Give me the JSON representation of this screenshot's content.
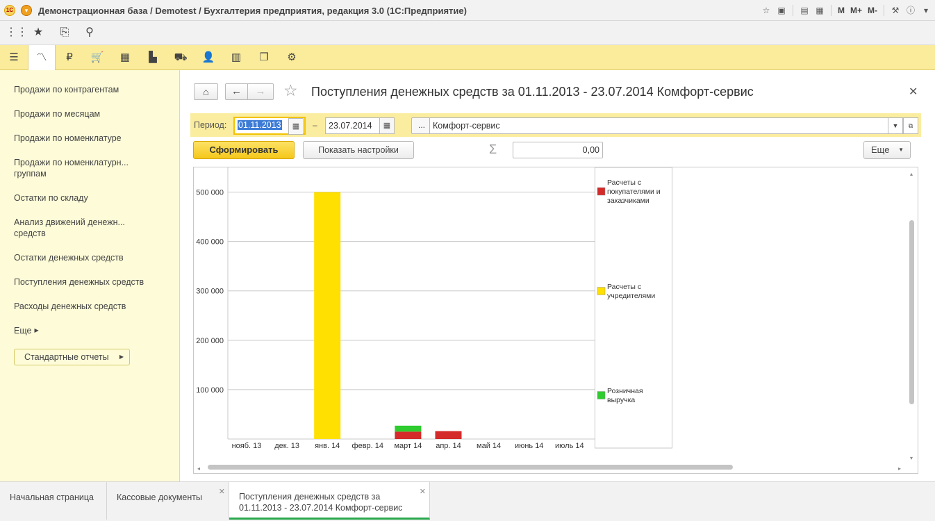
{
  "window": {
    "title": "Демонстрационная база / Demotest / Бухгалтерия предприятия, редакция 3.0 (1С:Предприятие)",
    "logo_text": "1С",
    "m_labels": [
      "M",
      "M+",
      "M-"
    ]
  },
  "sidebar": {
    "items": [
      "Продажи по контрагентам",
      "Продажи по месяцам",
      "Продажи по номенклатуре",
      "Продажи по номенклатурн... группам",
      "Остатки по складу",
      "Анализ движений денежн... средств",
      "Остатки денежных средств",
      "Поступления денежных средств",
      "Расходы денежных средств",
      "Еще"
    ],
    "std_button": "Стандартные отчеты"
  },
  "report": {
    "title": "Поступления денежных средств за 01.11.2013 - 23.07.2014 Комфорт-сервис",
    "period_label": "Период:",
    "date_from": "01.11.2013",
    "date_dash": "–",
    "date_to": "23.07.2014",
    "dots": "...",
    "org": "Комфорт-сервис",
    "form_button": "Сформировать",
    "settings_button": "Показать настройки",
    "sum_value": "0,00",
    "more_button": "Еще"
  },
  "chart_data": {
    "type": "bar",
    "stacked": true,
    "categories": [
      "нояб. 13",
      "дек. 13",
      "янв. 14",
      "февр. 14",
      "март 14",
      "апр. 14",
      "май 14",
      "июнь 14",
      "июль 14"
    ],
    "series": [
      {
        "name": "Расчеты с покупателями и заказчиками",
        "color": "#d42a2a",
        "values": [
          0,
          0,
          0,
          0,
          15000,
          16000,
          0,
          0,
          0
        ]
      },
      {
        "name": "Расчеты с учредителями",
        "color": "#ffe000",
        "values": [
          0,
          0,
          500000,
          0,
          0,
          0,
          0,
          0,
          0
        ]
      },
      {
        "name": "Розничная выручка",
        "color": "#2ecc2e",
        "values": [
          0,
          0,
          0,
          0,
          12000,
          0,
          0,
          0,
          0
        ]
      }
    ],
    "yticks": [
      "100 000",
      "200 000",
      "300 000",
      "400 000",
      "500 000"
    ],
    "ylim": [
      0,
      550000
    ],
    "grid": true,
    "legend": "right"
  },
  "tabs": [
    {
      "label": "Начальная страница"
    },
    {
      "label": "Кассовые документы"
    },
    {
      "label": "Поступления денежных средств за 01.11.2013 - 23.07.2014 Комфорт-сервис"
    }
  ]
}
